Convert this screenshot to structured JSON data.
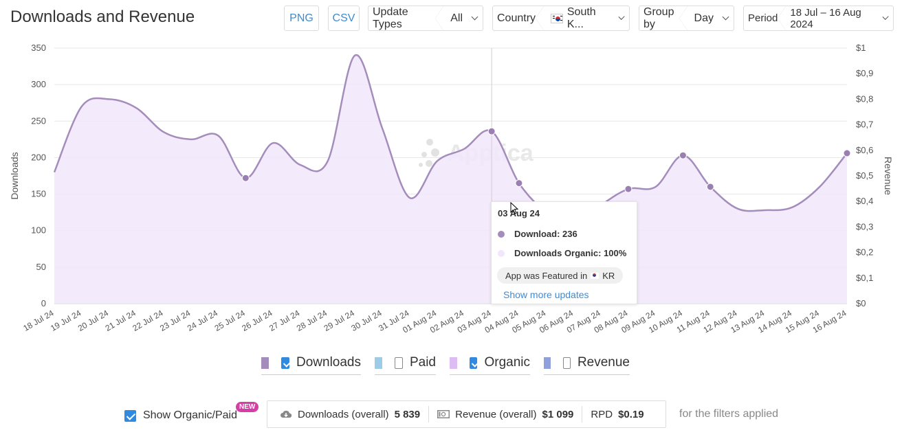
{
  "title": "Downloads and Revenue",
  "toolbar": {
    "png_label": "PNG",
    "csv_label": "CSV",
    "update_types": {
      "label": "Update Types",
      "value": "All"
    },
    "country": {
      "label": "Country",
      "value": "South K..."
    },
    "group_by": {
      "label": "Group by",
      "value": "Day"
    },
    "period": {
      "label": "Period",
      "value": "18 Jul – 16 Aug 2024"
    }
  },
  "watermark": "Apptica",
  "chart_data": {
    "type": "area",
    "x": [
      "18 Jul 24",
      "19 Jul 24",
      "20 Jul 24",
      "21 Jul 24",
      "22 Jul 24",
      "23 Jul 24",
      "24 Jul 24",
      "25 Jul 24",
      "26 Jul 24",
      "27 Jul 24",
      "28 Jul 24",
      "29 Jul 24",
      "30 Jul 24",
      "31 Jul 24",
      "01 Aug 24",
      "02 Aug 24",
      "03 Aug 24",
      "04 Aug 24",
      "05 Aug 24",
      "06 Aug 24",
      "07 Aug 24",
      "08 Aug 24",
      "09 Aug 24",
      "10 Aug 24",
      "11 Aug 24",
      "12 Aug 24",
      "13 Aug 24",
      "14 Aug 24",
      "15 Aug 24",
      "16 Aug 24"
    ],
    "series": [
      {
        "name": "Downloads",
        "color": "#a48cbb",
        "fill": "#f1e6fb",
        "values": [
          180,
          270,
          280,
          268,
          235,
          225,
          230,
          172,
          220,
          190,
          195,
          340,
          240,
          145,
          195,
          212,
          236,
          165,
          125,
          108,
          135,
          157,
          160,
          203,
          160,
          130,
          128,
          132,
          160,
          206
        ]
      }
    ],
    "markers": [
      7,
      16,
      17,
      21,
      23,
      24,
      29
    ],
    "ylabel": "Downloads",
    "ylim": [
      0,
      350
    ],
    "yticks": [
      0,
      50,
      100,
      150,
      200,
      250,
      300,
      350
    ],
    "ylabel_right": "Revenue",
    "yticks_right": [
      "$0",
      "$0,1",
      "$0,2",
      "$0,3",
      "$0,4",
      "$0,5",
      "$0,6",
      "$0,7",
      "$0,8",
      "$0,9",
      "$1"
    ],
    "grid": true,
    "crosshair_index": 16
  },
  "tooltip": {
    "date": "03 Aug 24",
    "download_label": "Download: 236",
    "organic_label": "Downloads Organic: 100%",
    "featured_text": "App was Featured in",
    "featured_country": "KR",
    "more_link": "Show more updates",
    "download_color": "#a48cbb",
    "organic_color": "#f1e6fb"
  },
  "legend": [
    {
      "label": "Downloads",
      "color": "#a48cbb",
      "checked": true
    },
    {
      "label": "Paid",
      "color": "#9dcce9",
      "checked": false
    },
    {
      "label": "Organic",
      "color": "#dcbcf2",
      "checked": true
    },
    {
      "label": "Revenue",
      "color": "#929fdd",
      "checked": false
    }
  ],
  "bottom": {
    "show_organic_paid": "Show Organic/Paid",
    "new_badge": "NEW",
    "downloads_label": "Downloads (overall)",
    "downloads_value": "5 839",
    "revenue_label": "Revenue (overall)",
    "revenue_value": "$1 099",
    "rpd_label": "RPD",
    "rpd_value": "$0.19",
    "note": "for the filters applied"
  }
}
